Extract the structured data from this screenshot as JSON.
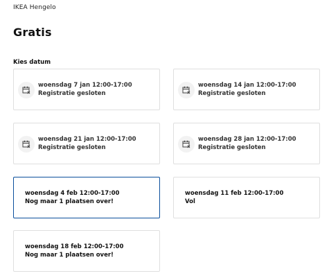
{
  "header": {
    "store": "IKEA Hengelo",
    "price": "Gratis"
  },
  "picker": {
    "label": "Kies datum",
    "slots": [
      {
        "date": "woensdag 7 jan 12:00-17:00",
        "status": "Registratie gesloten",
        "icon": "calendar-closed-icon"
      },
      {
        "date": "woensdag 14 jan 12:00-17:00",
        "status": "Registratie gesloten",
        "icon": "calendar-closed-icon"
      },
      {
        "date": "woensdag 21 jan 12:00-17:00",
        "status": "Registratie gesloten",
        "icon": "calendar-closed-icon"
      },
      {
        "date": "woensdag 28 jan 12:00-17:00",
        "status": "Registratie gesloten",
        "icon": "calendar-closed-icon"
      },
      {
        "date": "woensdag 4 feb 12:00-17:00",
        "status": "Nog maar 1 plaatsen over!",
        "selected": true
      },
      {
        "date": "woensdag 11 feb 12:00-17:00",
        "status": "Vol"
      },
      {
        "date": "woensdag 18 feb 12:00-17:00",
        "status": "Nog maar 1 plaatsen over!"
      }
    ]
  },
  "colors": {
    "selected_border": "#0a4e9c",
    "card_border": "#dfdfdf",
    "icon_bg": "#f2f2f2"
  }
}
